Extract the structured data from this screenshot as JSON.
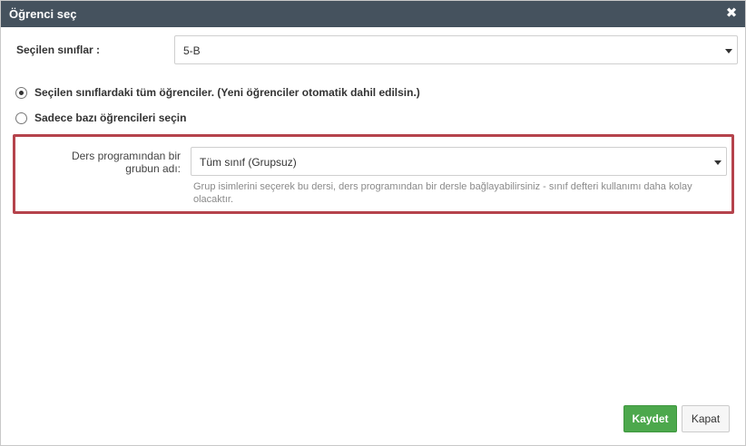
{
  "dialog": {
    "title": "Öğrenci seç",
    "close_icon": "close-icon"
  },
  "classes": {
    "label": "Seçilen sınıflar :",
    "selected": "5-B"
  },
  "options": {
    "all_students": "Seçilen sınıflardaki tüm öğrenciler. (Yeni öğrenciler otomatik dahil edilsin.)",
    "some_students": "Sadece bazı öğrencileri seçin",
    "selected_option": "all_students"
  },
  "group": {
    "label": "Ders programından bir grubun adı:",
    "selected": "Tüm sınıf (Grupsuz)",
    "help": "Grup isimlerini seçerek bu dersi, ders programından bir dersle bağlayabilirsiniz - sınıf defteri kullanımı daha kolay olacaktır."
  },
  "buttons": {
    "save": "Kaydet",
    "close": "Kapat"
  },
  "colors": {
    "titlebar": "#45525e",
    "highlight_border": "#b5434c",
    "save_button": "#4ca84c"
  }
}
